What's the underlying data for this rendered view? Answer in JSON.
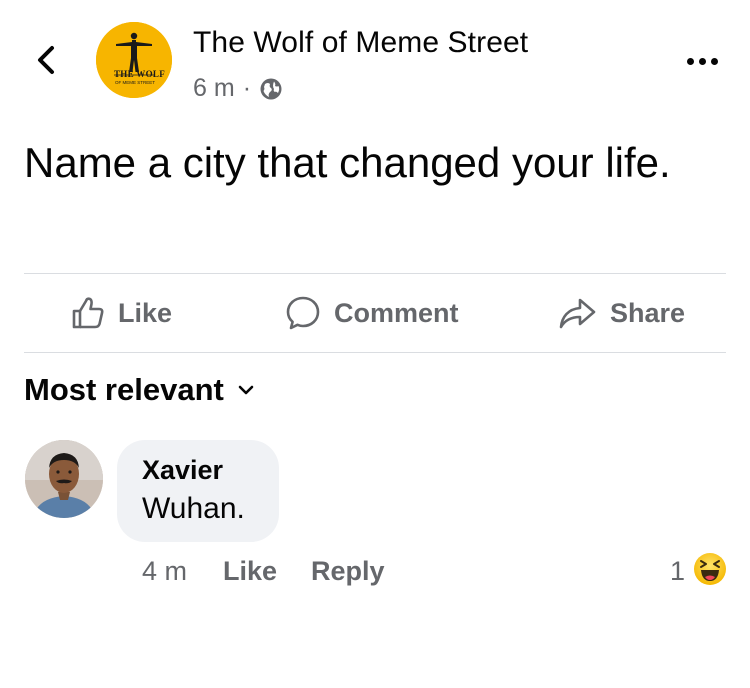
{
  "header": {
    "page_name": "The Wolf of Meme Street",
    "time": "6 m",
    "separator": "·",
    "logo_text": "THE WOLF",
    "logo_subtext": "OF MEME STREET"
  },
  "post": {
    "text": "Name a city that changed your life."
  },
  "actions": {
    "like": "Like",
    "comment": "Comment",
    "share": "Share"
  },
  "comments_sort": {
    "label": "Most relevant"
  },
  "comment": {
    "author": "Xavier",
    "text": "Wuhan.",
    "time": "4 m",
    "like": "Like",
    "reply": "Reply",
    "reaction_count": "1",
    "reaction_icon": "haha-emoji-icon"
  },
  "colors": {
    "logo_bg": "#f7b500",
    "secondary_text": "#65676b",
    "bubble_bg": "#f0f2f5",
    "divider": "#dadde1"
  }
}
